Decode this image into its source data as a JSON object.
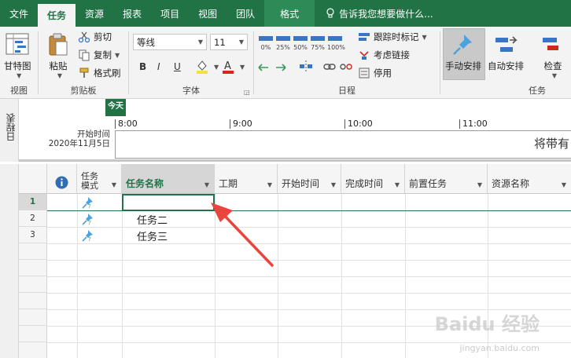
{
  "tabs": [
    {
      "label": "文件"
    },
    {
      "label": "任务",
      "active": true
    },
    {
      "label": "资源"
    },
    {
      "label": "报表"
    },
    {
      "label": "项目"
    },
    {
      "label": "视图"
    },
    {
      "label": "团队"
    }
  ],
  "format_tab": "格式",
  "tell_me": "告诉我您想要做什么...",
  "ribbon": {
    "view_group": {
      "label": "视图",
      "gantt": "甘特图"
    },
    "clipboard_group": {
      "label": "剪贴板",
      "paste": "粘贴",
      "cut": "剪切",
      "copy": "复制",
      "format_painter": "格式刷"
    },
    "font_group": {
      "label": "字体",
      "font_name": "等线",
      "font_size": "11",
      "bold": "B",
      "italic": "I",
      "underline": "U"
    },
    "schedule_group": {
      "label": "日程",
      "percents": [
        "0%",
        "25%",
        "50%",
        "75%",
        "100%"
      ],
      "mark_on_track": "跟踪时标记",
      "respect_links": "考虑链接",
      "inactivate": "停用"
    },
    "tasks_group": {
      "label": "任务",
      "manual": "手动安排",
      "auto": "自动安排",
      "inspect": "检查"
    }
  },
  "timeline": {
    "side_label": "日程表",
    "start_label": "开始时间",
    "start_date": "2020年11月5日",
    "today": "今天",
    "ticks": [
      "8:00",
      "9:00",
      "10:00",
      "11:00"
    ],
    "hint": "将带有"
  },
  "grid": {
    "columns": {
      "info": "i",
      "mode": "任务\n模式",
      "name": "任务名称",
      "duration": "工期",
      "start": "开始时间",
      "finish": "完成时间",
      "pred": "前置任务",
      "resource": "资源名称"
    },
    "rows": [
      {
        "num": "1",
        "name": ""
      },
      {
        "num": "2",
        "name": "任务二"
      },
      {
        "num": "3",
        "name": "任务三"
      }
    ]
  },
  "watermark": {
    "main": "Baidu 经验",
    "sub": "jingyan.baidu.com"
  },
  "colors": {
    "accent": "#217346",
    "arrow": "#e8463c",
    "bar_blue": "#3a75c4"
  }
}
